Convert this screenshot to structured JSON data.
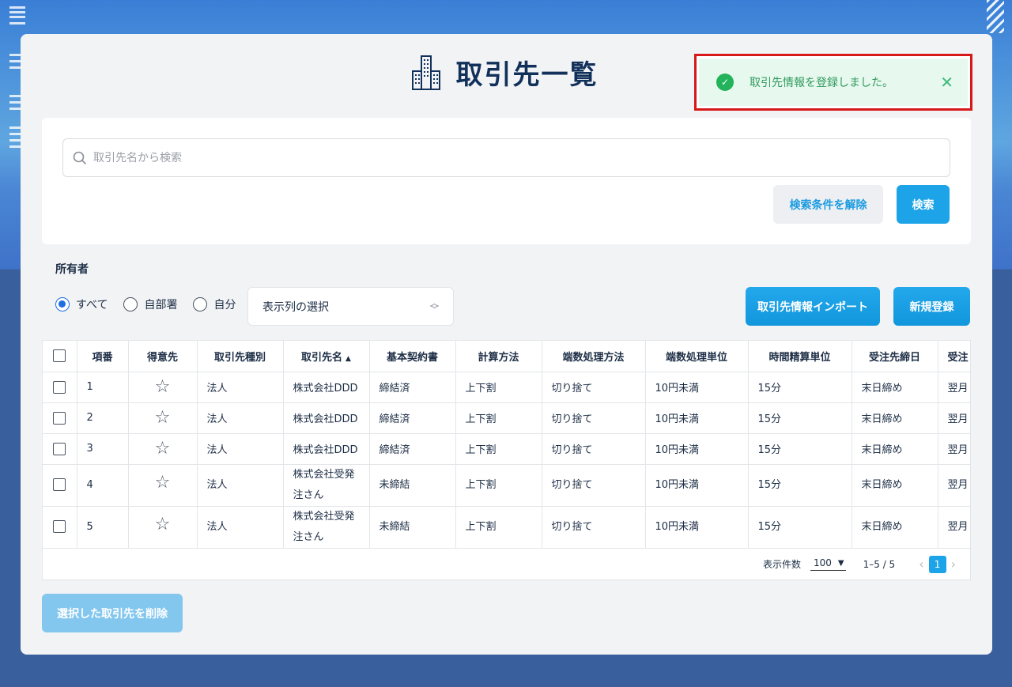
{
  "page": {
    "title": "取引先一覧"
  },
  "toast": {
    "message": "取引先情報を登録しました。",
    "close_glyph": "✕"
  },
  "search": {
    "placeholder": "取引先名から検索",
    "value": "",
    "clear_label": "検索条件を解除",
    "search_label": "検索"
  },
  "owner": {
    "label": "所有者",
    "options": [
      {
        "label": "すべて",
        "selected": true
      },
      {
        "label": "自部署",
        "selected": false
      },
      {
        "label": "自分",
        "selected": false
      }
    ]
  },
  "column_select": {
    "label": "表示列の選択"
  },
  "actions": {
    "import_label": "取引先情報インポート",
    "new_label": "新規登録",
    "delete_label": "選択した取引先を削除"
  },
  "table": {
    "headers": [
      "項番",
      "得意先",
      "取引先種別",
      "取引先名",
      "基本契約書",
      "計算方法",
      "端数処理方法",
      "端数処理単位",
      "時間精算単位",
      "受注先締日",
      "受注"
    ],
    "sort_indicator": "▲",
    "rows": [
      {
        "no": "1",
        "type": "法人",
        "name": "株式会社DDD",
        "contract": "締結済",
        "calc": "上下割",
        "rounding": "切り捨て",
        "unit": "10円未満",
        "time_unit": "15分",
        "closing": "末日締め",
        "next": "翌月"
      },
      {
        "no": "2",
        "type": "法人",
        "name": "株式会社DDD",
        "contract": "締結済",
        "calc": "上下割",
        "rounding": "切り捨て",
        "unit": "10円未満",
        "time_unit": "15分",
        "closing": "末日締め",
        "next": "翌月"
      },
      {
        "no": "3",
        "type": "法人",
        "name": "株式会社DDD",
        "contract": "締結済",
        "calc": "上下割",
        "rounding": "切り捨て",
        "unit": "10円未満",
        "time_unit": "15分",
        "closing": "末日締め",
        "next": "翌月"
      },
      {
        "no": "4",
        "type": "法人",
        "name": "株式会社受発注さん",
        "contract": "未締結",
        "calc": "上下割",
        "rounding": "切り捨て",
        "unit": "10円未満",
        "time_unit": "15分",
        "closing": "末日締め",
        "next": "翌月"
      },
      {
        "no": "5",
        "type": "法人",
        "name": "株式会社受発注さん",
        "contract": "未締結",
        "calc": "上下割",
        "rounding": "切り捨て",
        "unit": "10円未満",
        "time_unit": "15分",
        "closing": "末日締め",
        "next": "翌月"
      }
    ]
  },
  "pagination": {
    "per_page_label": "表示件数",
    "per_page_value": "100",
    "range_text": "1–5 / 5",
    "current_page": "1"
  },
  "icons": {
    "title": "office-building-icon",
    "toast": "check-circle-icon",
    "search": "search-icon",
    "favorite": "star-outline-icon"
  },
  "colors": {
    "accent": "#1da4e8",
    "title": "#12315a",
    "toast_border": "#d71818",
    "toast_bg": "#e7f8ee",
    "success": "#22b35b"
  }
}
